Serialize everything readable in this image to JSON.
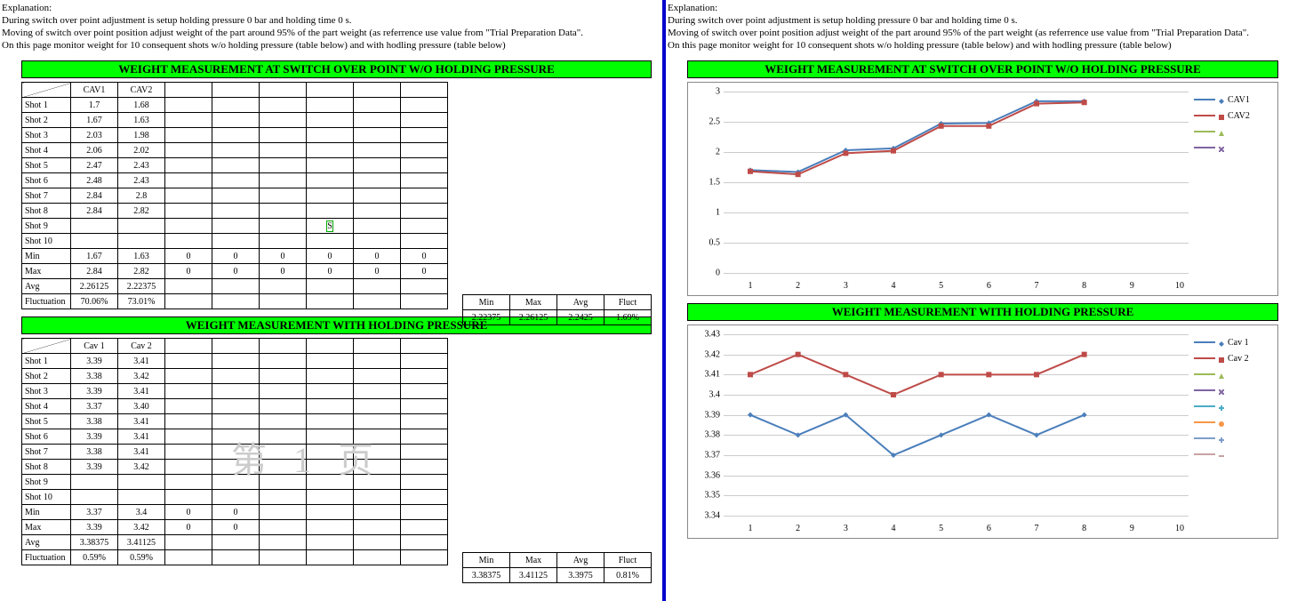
{
  "explanation": {
    "heading": "Explanation:",
    "l1": "During switch over point adjustment is setup holding pressure 0 bar and holding time 0 s.",
    "l2": "Moving of switch over point position adjust weight of the part around 95% of the part weight (as referrence use value from \"Trial Preparation Data\".",
    "l3": "On this page monitor weight for 10 consequent shots w/o holding pressure (table below) and with hodling pressure (table below)"
  },
  "titles": {
    "t1": "WEIGHT MEASUREMENT AT SWITCH OVER POINT W/O HOLDING PRESSURE",
    "t2": "WEIGHT MEASUREMENT WITH HOLDING PRESSURE"
  },
  "table1": {
    "headers": [
      "CAV1",
      "CAV2"
    ],
    "rows": [
      {
        "label": "Shot 1",
        "v": [
          "1.7",
          "1.68"
        ]
      },
      {
        "label": "Shot 2",
        "v": [
          "1.67",
          "1.63"
        ]
      },
      {
        "label": "Shot 3",
        "v": [
          "2.03",
          "1.98"
        ]
      },
      {
        "label": "Shot 4",
        "v": [
          "2.06",
          "2.02"
        ]
      },
      {
        "label": "Shot 5",
        "v": [
          "2.47",
          "2.43"
        ]
      },
      {
        "label": "Shot 6",
        "v": [
          "2.48",
          "2.43"
        ]
      },
      {
        "label": "Shot 7",
        "v": [
          "2.84",
          "2.8"
        ]
      },
      {
        "label": "Shot 8",
        "v": [
          "2.84",
          "2.82"
        ]
      },
      {
        "label": "Shot 9",
        "v": [
          "",
          ""
        ],
        "edit": "S"
      },
      {
        "label": "Shot 10",
        "v": [
          "",
          ""
        ]
      }
    ],
    "stats": {
      "Min": [
        "1.67",
        "1.63",
        "0",
        "0",
        "0",
        "0",
        "0",
        "0"
      ],
      "Max": [
        "2.84",
        "2.82",
        "0",
        "0",
        "0",
        "0",
        "0",
        "0"
      ],
      "Avg": [
        "2.26125",
        "2.22375",
        "",
        "",
        "",
        "",
        "",
        ""
      ],
      "Fluctuation": [
        "70.06%",
        "73.01%",
        "",
        "",
        "",
        "",
        "",
        ""
      ]
    },
    "summary": {
      "labels": [
        "Min",
        "Max",
        "Avg",
        "Fluct"
      ],
      "values": [
        "2.22375",
        "2.26125",
        "2.2425",
        "1.69%"
      ]
    }
  },
  "table2": {
    "headers": [
      "Cav 1",
      "Cav 2"
    ],
    "rows": [
      {
        "label": "Shot 1",
        "v": [
          "3.39",
          "3.41"
        ]
      },
      {
        "label": "Shot 2",
        "v": [
          "3.38",
          "3.42"
        ]
      },
      {
        "label": "Shot 3",
        "v": [
          "3.39",
          "3.41"
        ]
      },
      {
        "label": "Shot 4",
        "v": [
          "3.37",
          "3.40"
        ]
      },
      {
        "label": "Shot 5",
        "v": [
          "3.38",
          "3.41"
        ]
      },
      {
        "label": "Shot 6",
        "v": [
          "3.39",
          "3.41"
        ]
      },
      {
        "label": "Shot 7",
        "v": [
          "3.38",
          "3.41"
        ]
      },
      {
        "label": "Shot 8",
        "v": [
          "3.39",
          "3.42"
        ]
      },
      {
        "label": "Shot 9",
        "v": [
          "",
          ""
        ]
      },
      {
        "label": "Shot 10",
        "v": [
          "",
          ""
        ]
      }
    ],
    "stats": {
      "Min": [
        "3.37",
        "3.4",
        "0",
        "0",
        "",
        "",
        "",
        ""
      ],
      "Max": [
        "3.39",
        "3.42",
        "0",
        "0",
        "",
        "",
        "",
        ""
      ],
      "Avg": [
        "3.38375",
        "3.41125",
        "",
        "",
        "",
        "",
        "",
        ""
      ],
      "Fluctuation": [
        "0.59%",
        "0.59%",
        "",
        "",
        "",
        "",
        "",
        ""
      ]
    },
    "summary": {
      "labels": [
        "Min",
        "Max",
        "Avg",
        "Fluct"
      ],
      "values": [
        "3.38375",
        "3.41125",
        "3.3975",
        "0.81%"
      ]
    }
  },
  "watermark": "第 1 页",
  "chart_data": [
    {
      "type": "line",
      "title": "WEIGHT MEASUREMENT AT SWITCH OVER POINT W/O HOLDING PRESSURE",
      "x": [
        1,
        2,
        3,
        4,
        5,
        6,
        7,
        8,
        9,
        10
      ],
      "ylim": [
        0,
        3
      ],
      "yticks": [
        0,
        0.5,
        1,
        1.5,
        2,
        2.5,
        3
      ],
      "series": [
        {
          "name": "CAV1",
          "color": "#4a7ebb",
          "marker": "diamond",
          "values": [
            1.7,
            1.67,
            2.03,
            2.06,
            2.47,
            2.48,
            2.84,
            2.84
          ]
        },
        {
          "name": "CAV2",
          "color": "#be4b48",
          "marker": "square",
          "values": [
            1.68,
            1.63,
            1.98,
            2.02,
            2.43,
            2.43,
            2.8,
            2.82
          ]
        }
      ],
      "extra_legend": [
        {
          "color": "#9bbb59",
          "marker": "triangle"
        },
        {
          "color": "#8064a2",
          "marker": "x"
        }
      ]
    },
    {
      "type": "line",
      "title": "WEIGHT MEASUREMENT WITH HOLDING PRESSURE",
      "x": [
        1,
        2,
        3,
        4,
        5,
        6,
        7,
        8,
        9,
        10
      ],
      "ylim": [
        3.34,
        3.43
      ],
      "yticks": [
        3.34,
        3.35,
        3.36,
        3.37,
        3.38,
        3.39,
        3.4,
        3.41,
        3.42,
        3.43
      ],
      "series": [
        {
          "name": "Cav 1",
          "color": "#4a7ebb",
          "marker": "diamond",
          "values": [
            3.39,
            3.38,
            3.39,
            3.37,
            3.38,
            3.39,
            3.38,
            3.39
          ]
        },
        {
          "name": "Cav 2",
          "color": "#be4b48",
          "marker": "square",
          "values": [
            3.41,
            3.42,
            3.41,
            3.4,
            3.41,
            3.41,
            3.41,
            3.42
          ]
        }
      ],
      "extra_legend": [
        {
          "color": "#9bbb59",
          "marker": "triangle"
        },
        {
          "color": "#8064a2",
          "marker": "x"
        },
        {
          "color": "#4bacc6",
          "marker": "star"
        },
        {
          "color": "#f79646",
          "marker": "circle"
        },
        {
          "color": "#7f9ec8",
          "marker": "plus"
        },
        {
          "color": "#c8a2a2",
          "marker": "dash"
        }
      ]
    }
  ]
}
